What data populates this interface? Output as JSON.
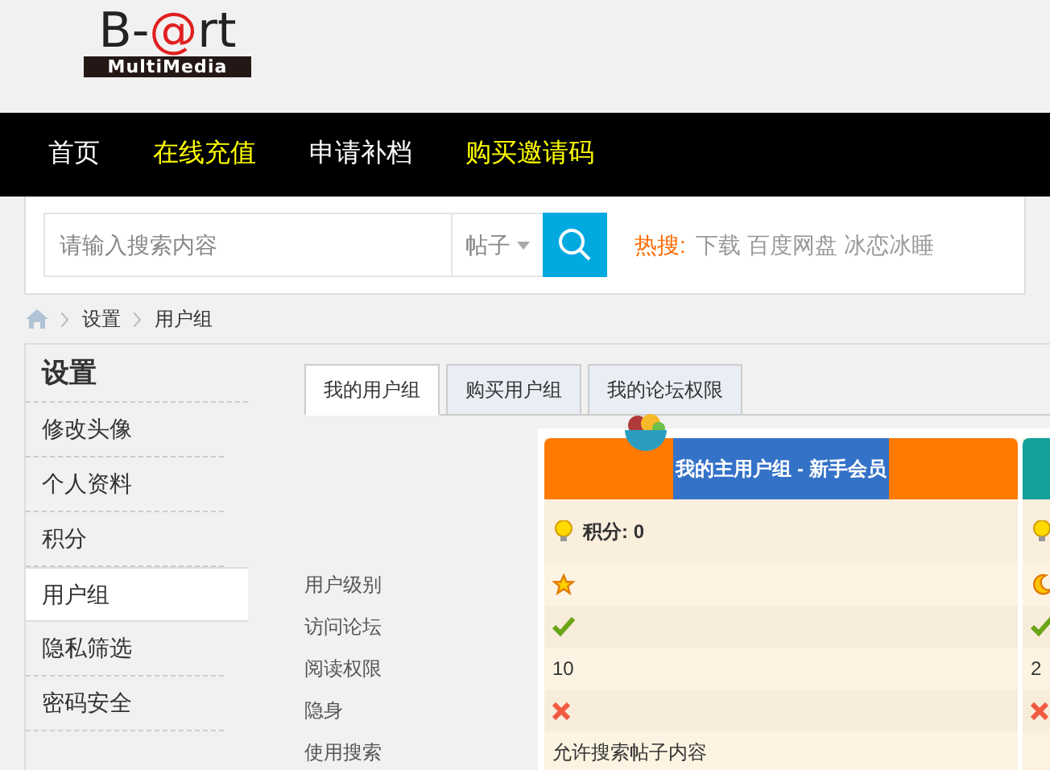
{
  "logo": {
    "before": "B-",
    "mark": "@",
    "after": "rt",
    "subtitle": "MultiMedia"
  },
  "nav": [
    {
      "label": "首页",
      "color": "#ffffff"
    },
    {
      "label": "在线充值",
      "color": "#ffff00"
    },
    {
      "label": "申请补档",
      "color": "#ffffff"
    },
    {
      "label": "购买邀请码",
      "color": "#ffff00"
    }
  ],
  "search": {
    "placeholder": "请输入搜索内容",
    "scope": "帖子",
    "hot_label": "热搜:",
    "hot_terms": [
      "下载",
      "百度网盘",
      "冰恋冰睡"
    ]
  },
  "breadcrumb": [
    "设置",
    "用户组"
  ],
  "sidebar": {
    "title": "设置",
    "items": [
      {
        "label": "修改头像",
        "selected": false
      },
      {
        "label": "个人资料",
        "selected": false
      },
      {
        "label": "积分",
        "selected": false
      },
      {
        "label": "用户组",
        "selected": true
      },
      {
        "label": "隐私筛选",
        "selected": false
      },
      {
        "label": "密码安全",
        "selected": false
      }
    ]
  },
  "tabs": [
    {
      "label": "我的用户组",
      "selected": true
    },
    {
      "label": "购买用户组",
      "selected": false
    },
    {
      "label": "我的论坛权限",
      "selected": false
    }
  ],
  "permission_labels": [
    "用户级别",
    "访问论坛",
    "阅读权限",
    "隐身",
    "使用搜索"
  ],
  "groups": [
    {
      "title": "我的主用户组 - 新手会员",
      "color": "#ff7a00",
      "points": "积分: 0",
      "values": [
        {
          "kind": "star"
        },
        {
          "kind": "yes"
        },
        {
          "kind": "text",
          "text": "10"
        },
        {
          "kind": "no"
        },
        {
          "kind": "text",
          "text": "允许搜索帖子内容"
        }
      ]
    },
    {
      "color": "#13a19c",
      "values": [
        {
          "kind": "moon"
        },
        {
          "kind": "yes"
        },
        {
          "kind": "text",
          "text": "2"
        },
        {
          "kind": "no"
        }
      ]
    }
  ]
}
